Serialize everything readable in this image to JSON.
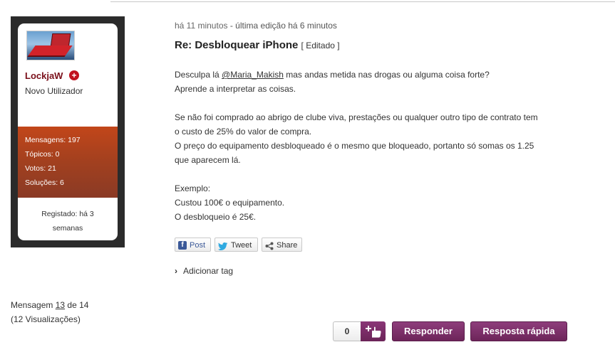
{
  "author": {
    "username": "LockjaW",
    "rank": "Novo Utilizador",
    "stats": [
      {
        "label": "Mensagens: 197"
      },
      {
        "label": "Tópicos: 0"
      },
      {
        "label": "Votos: 21"
      },
      {
        "label": "Soluções: 6"
      }
    ],
    "registered_line1": "Registado: há 3",
    "registered_line2": "semanas"
  },
  "post": {
    "time": "há 11 minutos",
    "edit_info": "- última edição há 6 minutos",
    "title": "Re: Desbloquear iPhone",
    "edited_label": "[ Editado ]",
    "mention": "@Maria_Makish",
    "body": {
      "p1_prefix": "Desculpa lá",
      "p1_suffix": "mas andas metida nas drogas ou alguma coisa forte?",
      "p2": "Aprende a interpretar as coisas.",
      "p3": "Se não foi comprado ao abrigo de clube viva, prestações ou qualquer outro tipo de contrato tem",
      "p4": "o custo de 25% do valor de compra.",
      "p5": "O preço do equipamento desbloqueado é o mesmo que bloqueado, portanto só somas os 1.25",
      "p6": "que aparecem lá.",
      "p7": "Exemplo:",
      "p8": "Custou 100€ o equipamento.",
      "p9": "O desbloqueio é 25€."
    }
  },
  "share": {
    "post_label": "Post",
    "tweet_label": "Tweet",
    "share_label": "Share"
  },
  "tags": {
    "add_label": "Adicionar tag"
  },
  "message_count": {
    "prefix": "Mensagem",
    "current": "13",
    "suffix": "de 14",
    "views": "(12 Visualizações)"
  },
  "actions": {
    "kudos_count": "0",
    "reply_label": "Responder",
    "quick_reply_label": "Resposta rápida"
  }
}
